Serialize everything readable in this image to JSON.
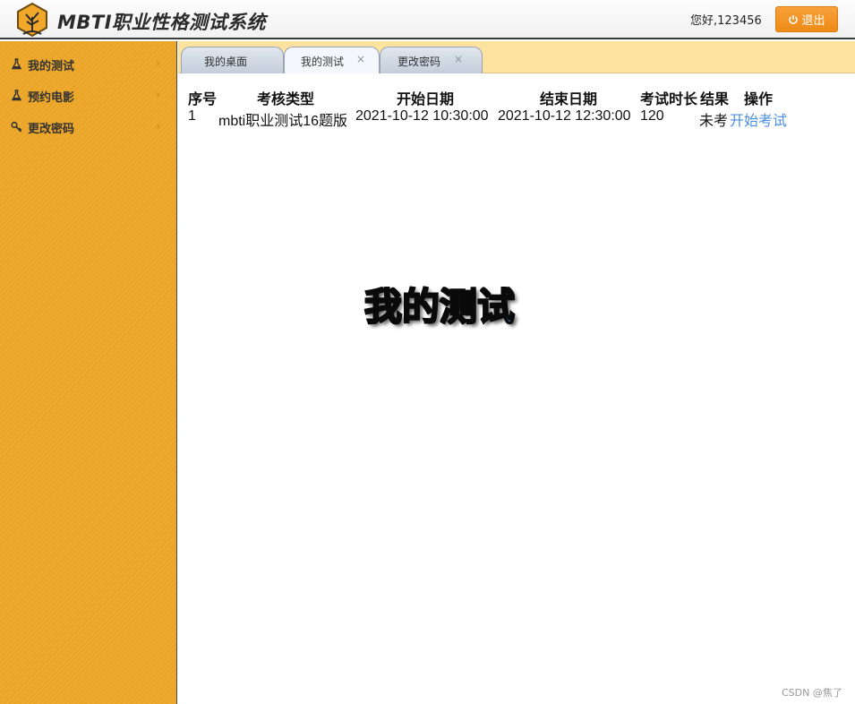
{
  "header": {
    "app_title": "MBTI职业性格测试系统",
    "greeting": "您好,123456",
    "logout_label": "退出",
    "logo_icon": "beehive-tree-logo",
    "logout_icon": "power-icon",
    "colors": {
      "accent": "#ee8a17",
      "border": "#3b3b3b"
    }
  },
  "sidebar": {
    "background": "#eba526",
    "items": [
      {
        "label": "我的测试",
        "icon": "flask-icon"
      },
      {
        "label": "预约电影",
        "icon": "flask-icon"
      },
      {
        "label": "更改密码",
        "icon": "key-icon"
      }
    ],
    "arrow_glyph": "›"
  },
  "tabs": [
    {
      "label": "我的桌面",
      "active": false,
      "closable": false
    },
    {
      "label": "我的测试",
      "active": true,
      "closable": true,
      "close_glyph": "×"
    },
    {
      "label": "更改密码",
      "active": false,
      "closable": true,
      "close_glyph": "×"
    }
  ],
  "table": {
    "headers": [
      "序号",
      "考核类型",
      "开始日期",
      "结束日期",
      "考试时长",
      "结果",
      "操作"
    ],
    "rows": [
      {
        "index": "1",
        "type": "mbti职业测试16题版",
        "start": "2021-10-12 10:30:00",
        "end": "2021-10-12 12:30:00",
        "duration": "120",
        "result": "未考",
        "action": "开始考试"
      }
    ]
  },
  "page_heading": "我的测试",
  "footer_credit": "CSDN @焦了"
}
